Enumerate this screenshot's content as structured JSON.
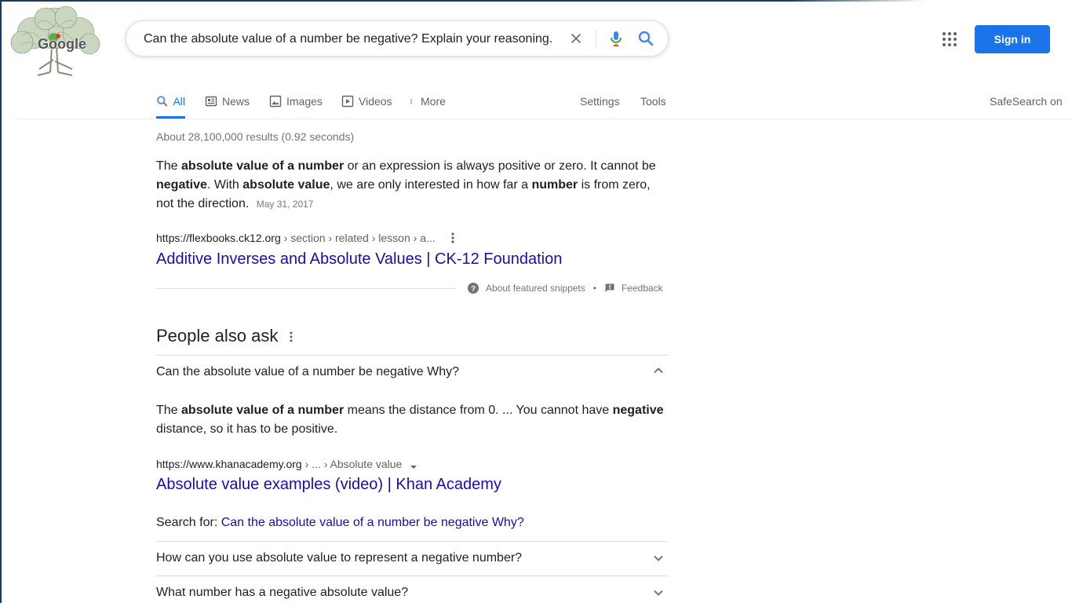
{
  "search": {
    "query": "Can the absolute value of a number be negative? Explain your reasoning."
  },
  "header": {
    "logo_text": "Google",
    "signin_label": "Sign in"
  },
  "tabs": [
    {
      "label": "All",
      "icon": "search-icon",
      "active": true
    },
    {
      "label": "News",
      "icon": "news-icon"
    },
    {
      "label": "Images",
      "icon": "images-icon"
    },
    {
      "label": "Videos",
      "icon": "videos-icon"
    },
    {
      "label": "More",
      "icon": "more-vert-icon"
    }
  ],
  "tools_bar": {
    "settings_label": "Settings",
    "tools_label": "Tools",
    "safesearch_label": "SafeSearch on"
  },
  "stats": "About 28,100,000 results (0.92 seconds)",
  "featured": {
    "text_parts": [
      {
        "t": "The ",
        "b": false
      },
      {
        "t": "absolute value of a number",
        "b": true
      },
      {
        "t": " or an expression is always positive or zero. It cannot be ",
        "b": false
      },
      {
        "t": "negative",
        "b": true
      },
      {
        "t": ". With ",
        "b": false
      },
      {
        "t": "absolute value",
        "b": true
      },
      {
        "t": ", we are only interested in how far a ",
        "b": false
      },
      {
        "t": "number",
        "b": true
      },
      {
        "t": " is from zero, not the direction.",
        "b": false
      }
    ],
    "date": "May 31, 2017",
    "cite_domain": "https://flexbooks.ck12.org",
    "cite_path": " › section › related › lesson › a...",
    "title": "Additive Inverses and Absolute Values | CK-12 Foundation",
    "about_label": "About featured snippets",
    "separator": "•",
    "feedback_label": "Feedback"
  },
  "paa": {
    "title": "People also ask",
    "questions": [
      "Can the absolute value of a number be negative Why?",
      "How can you use absolute value to represent a negative number?",
      "What number has a negative absolute value?"
    ],
    "answer_parts": [
      {
        "t": "The ",
        "b": false
      },
      {
        "t": "absolute value of a number",
        "b": true
      },
      {
        "t": " means the distance from 0. ... You cannot have ",
        "b": false
      },
      {
        "t": "negative",
        "b": true
      },
      {
        "t": " distance, so it has to be positive.",
        "b": false
      }
    ],
    "cite_domain": "https://www.khanacademy.org",
    "cite_path": " › ... › Absolute value",
    "answer_title": "Absolute value examples (video) | Khan Academy",
    "search_for_label": "Search for: ",
    "search_for_link": "Can the absolute value of a number be negative Why?"
  },
  "colors": {
    "accent": "#1a73e8",
    "link": "#1a0dab",
    "secondary_text": "#70757a"
  }
}
